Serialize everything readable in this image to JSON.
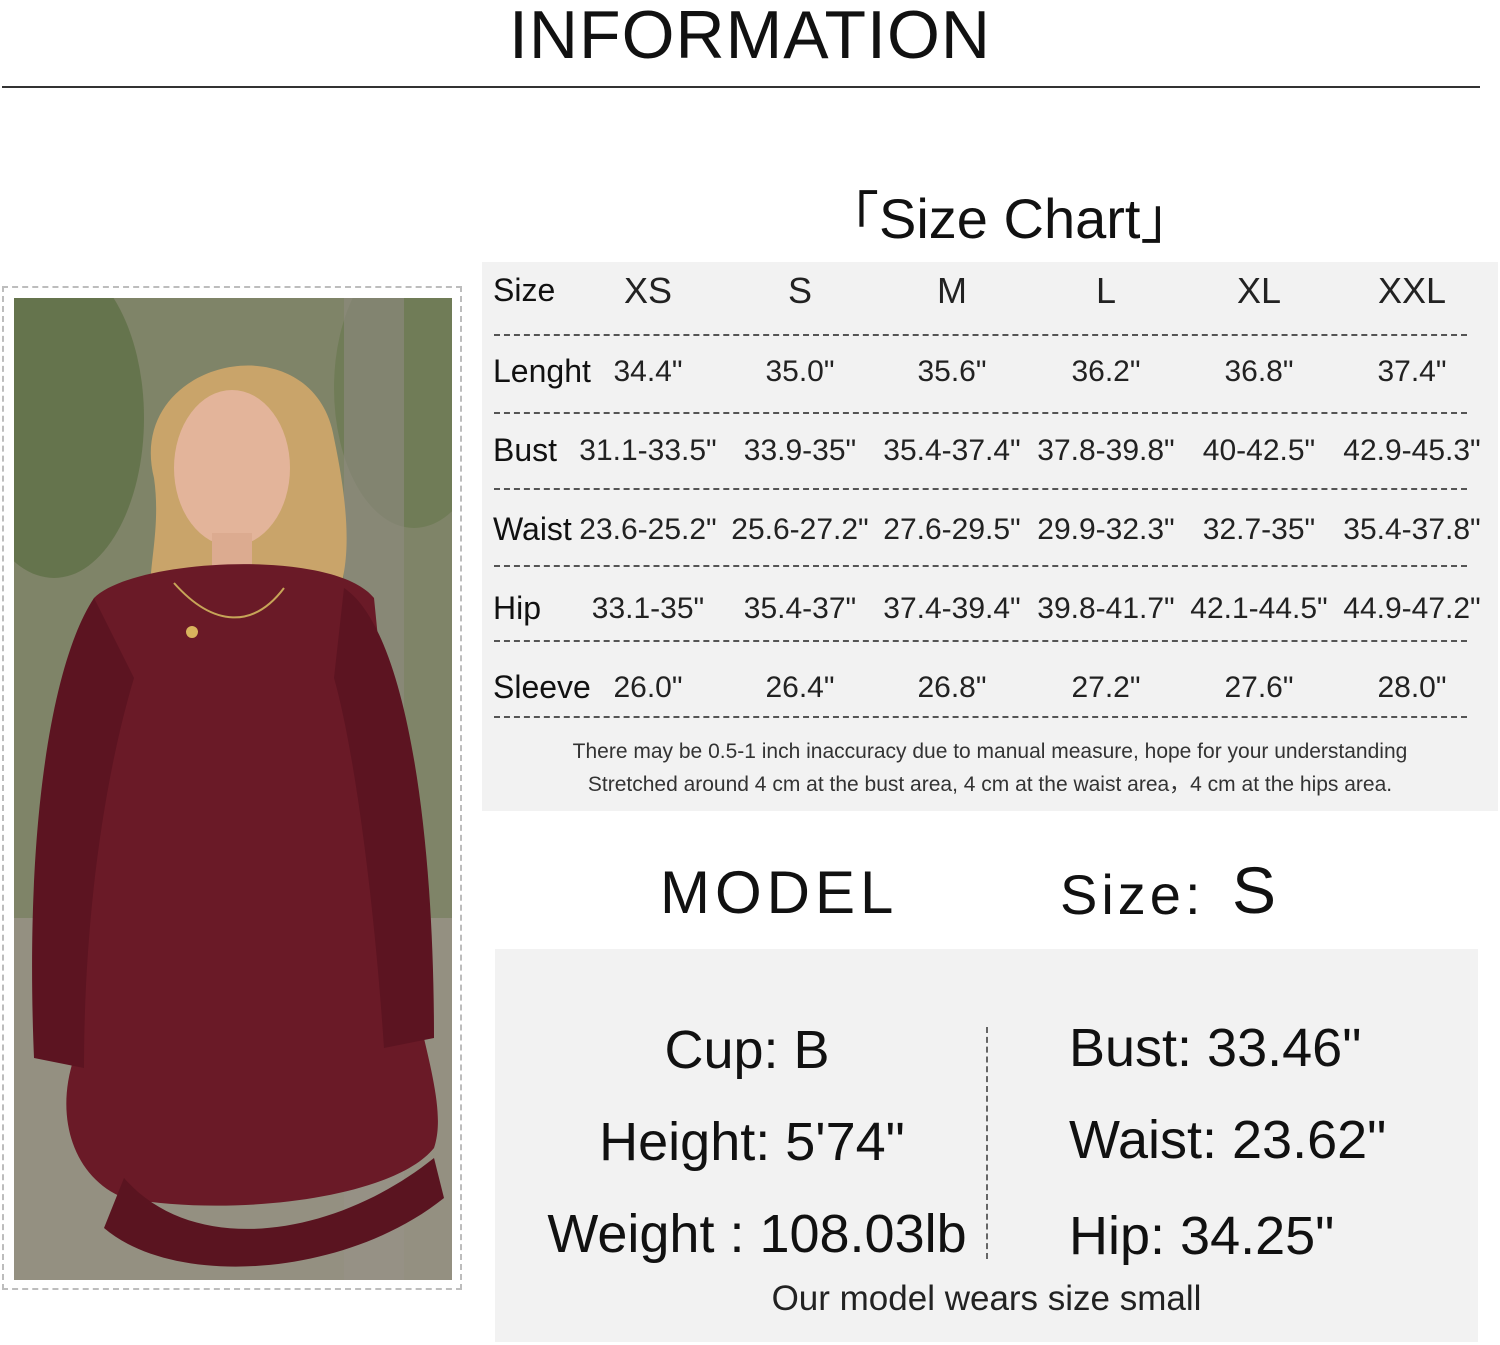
{
  "header": {
    "title": "INFORMATION"
  },
  "photo": {
    "icon": "model-photo",
    "dress_color": "#6a1a27"
  },
  "size_chart": {
    "heading": "「Size Chart」",
    "size_label": "Size",
    "sizes": [
      "XS",
      "S",
      "M",
      "L",
      "XL",
      "XXL"
    ],
    "rows": [
      {
        "label": "Lenght",
        "values": [
          "34.4\"",
          "35.0\"",
          "35.6\"",
          "36.2\"",
          "36.8\"",
          "37.4\""
        ]
      },
      {
        "label": "Bust",
        "values": [
          "31.1-33.5\"",
          "33.9-35\"",
          "35.4-37.4\"",
          "37.8-39.8\"",
          "40-42.5\"",
          "42.9-45.3\""
        ]
      },
      {
        "label": "Waist",
        "values": [
          "23.6-25.2\"",
          "25.6-27.2\"",
          "27.6-29.5\"",
          "29.9-32.3\"",
          "32.7-35\"",
          "35.4-37.8\""
        ]
      },
      {
        "label": "Hip",
        "values": [
          "33.1-35\"",
          "35.4-37\"",
          "37.4-39.4\"",
          "39.8-41.7\"",
          "42.1-44.5\"",
          "44.9-47.2\""
        ]
      },
      {
        "label": "Sleeve",
        "values": [
          "26.0\"",
          "26.4\"",
          "26.8\"",
          "27.2\"",
          "27.6\"",
          "28.0\""
        ]
      }
    ],
    "notes": [
      "There may be 0.5-1 inch inaccuracy due to manual measure, hope for your understanding",
      "Stretched around 4 cm at the bust area, 4 cm at the waist area，4 cm at the hips area."
    ]
  },
  "model": {
    "label": "MODEL",
    "size_label": "Size:",
    "size_value": "S",
    "left": [
      "Cup: B",
      "Height: 5'74\"",
      "Weight : 108.03lb"
    ],
    "right": [
      "Bust: 33.46\"",
      "Waist: 23.62\"",
      "Hip: 34.25\""
    ],
    "note": "Our model wears size small"
  }
}
